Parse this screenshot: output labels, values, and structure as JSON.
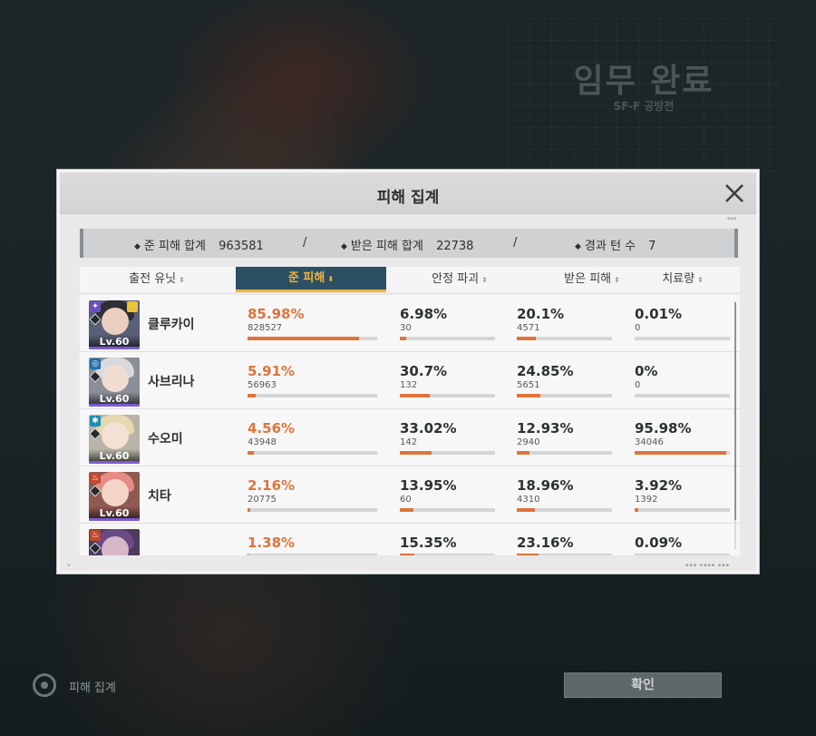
{
  "mission": {
    "title": "임무 완료",
    "subtitle": "SF-F 공방전"
  },
  "modal": {
    "title": "피해 집계",
    "summary": {
      "dealt_label": "준 피해 합계",
      "dealt_value": "963581",
      "taken_label": "받은 피해 합계",
      "taken_value": "22738",
      "turns_label": "경과 턴 수",
      "turns_value": "7",
      "separator": "/"
    },
    "columns": [
      {
        "label": "출전 유닛",
        "sort_icon": "sort-icon"
      },
      {
        "label": "준 피해",
        "sort_icon": "sort-desc-icon",
        "active": true
      },
      {
        "label": "안정 파괴",
        "sort_icon": "sort-icon"
      },
      {
        "label": "받은 피해",
        "sort_icon": "sort-icon"
      },
      {
        "label": "치료량",
        "sort_icon": "sort-icon"
      }
    ],
    "rows": [
      {
        "name": "클루카이",
        "level": "Lv.60",
        "element_icon": "phase-icon",
        "element_color": "#6a4fc0",
        "dmg_pct": "85.98%",
        "dmg_val": "828527",
        "dmg_fill": 0.86,
        "stab_pct": "6.98%",
        "stab_val": "30",
        "stab_fill": 0.07,
        "taken_pct": "20.1%",
        "taken_val": "4571",
        "taken_fill": 0.2,
        "heal_pct": "0.01%",
        "heal_val": "0",
        "heal_fill": 0.0
      },
      {
        "name": "사브리나",
        "level": "Lv.60",
        "element_icon": "hydro-icon",
        "element_color": "#1f6ea8",
        "dmg_pct": "5.91%",
        "dmg_val": "56963",
        "dmg_fill": 0.06,
        "stab_pct": "30.7%",
        "stab_val": "132",
        "stab_fill": 0.31,
        "taken_pct": "24.85%",
        "taken_val": "5651",
        "taken_fill": 0.25,
        "heal_pct": "0%",
        "heal_val": "0",
        "heal_fill": 0.0
      },
      {
        "name": "수오미",
        "level": "Lv.60",
        "element_icon": "freeze-icon",
        "element_color": "#1a8fb0",
        "dmg_pct": "4.56%",
        "dmg_val": "43948",
        "dmg_fill": 0.05,
        "stab_pct": "33.02%",
        "stab_val": "142",
        "stab_fill": 0.33,
        "taken_pct": "12.93%",
        "taken_val": "2940",
        "taken_fill": 0.13,
        "heal_pct": "95.98%",
        "heal_val": "34046",
        "heal_fill": 0.96
      },
      {
        "name": "치타",
        "level": "Lv.60",
        "element_icon": "burn-icon",
        "element_color": "#c2492c",
        "dmg_pct": "2.16%",
        "dmg_val": "20775",
        "dmg_fill": 0.02,
        "stab_pct": "13.95%",
        "stab_val": "60",
        "stab_fill": 0.14,
        "taken_pct": "18.96%",
        "taken_val": "4310",
        "taken_fill": 0.19,
        "heal_pct": "3.92%",
        "heal_val": "1392",
        "heal_fill": 0.04
      },
      {
        "name": "",
        "level": "",
        "element_icon": "burn-icon",
        "element_color": "#c2492c",
        "dmg_pct": "1.38%",
        "dmg_val": "",
        "dmg_fill": 0.01,
        "stab_pct": "15.35%",
        "stab_val": "",
        "stab_fill": 0.15,
        "taken_pct": "23.16%",
        "taken_val": "",
        "taken_fill": 0.23,
        "heal_pct": "0.09%",
        "heal_val": "",
        "heal_fill": 0.0
      }
    ],
    "close_icon": "close-icon"
  },
  "footer": {
    "damage_toggle": "피해 집계",
    "confirm": "확인"
  },
  "colors": {
    "accent": "#e0743a",
    "active_header": "#2d4f64",
    "active_text": "#f0b43a"
  }
}
